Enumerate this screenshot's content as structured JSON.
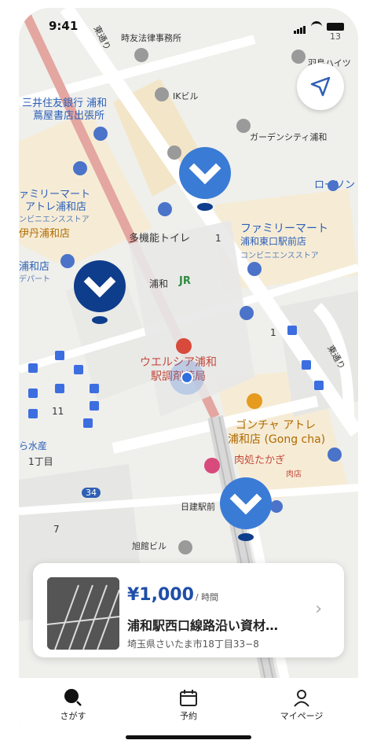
{
  "status": {
    "time": "9:41",
    "carrier_text": "13"
  },
  "map": {
    "labels": {
      "road_top": "東通り",
      "law_office": "時友法律事務所",
      "hights": "羽鳥ハイツ",
      "ik_bld": "IKビル",
      "bank1": "三井住友銀行 浦和",
      "bank2": "蔦屋書店出張所",
      "garden": "ガーデンシティ浦和",
      "lawson": "ローソン",
      "family_west1": "ァミリーマート",
      "family_west2": "アトレ浦和店",
      "family_west3": "ンビニエンスストア",
      "isetan": "伊丹浦和店",
      "toilet": "多機能トイレ",
      "num1": "1",
      "family_east1": "ファミリーマート",
      "family_east2": "浦和東口駅前店",
      "family_east3": "コンビニエンスストア",
      "urawa_store1": "浦和店",
      "urawa_store2": "デパート",
      "urawa_jr": "浦和",
      "jr": "JR",
      "welcia1": "ウエルシア浦和",
      "welcia2": "駅調剤薬局",
      "num2": "1",
      "num11": "11",
      "suisan": "ら水産",
      "chome": "1丁目",
      "gongcha1": "ゴンチャ アトレ",
      "gongcha2": "浦和店 (Gong cha)",
      "meat1": "肉処たかぎ",
      "meat2": "肉店",
      "route": "34",
      "nikken": "日建駅前",
      "num7": "7",
      "asahi": "旭館ビル",
      "road_east": "東通り"
    }
  },
  "card": {
    "price": "¥1,000",
    "unit": "/ 時間",
    "name": "浦和駅西口線路沿い資材…",
    "address": "埼玉県さいたま市18丁目33−8"
  },
  "tabbar": {
    "tabs": [
      {
        "label": "さがす",
        "icon": "search-icon"
      },
      {
        "label": "予約",
        "icon": "calendar-icon"
      },
      {
        "label": "マイページ",
        "icon": "person-icon"
      }
    ]
  },
  "colors": {
    "pin": "#3a7bd5",
    "pin_dark": "#0e3d8c",
    "price": "#1e4ea8",
    "rail": "#e4a6a0"
  }
}
